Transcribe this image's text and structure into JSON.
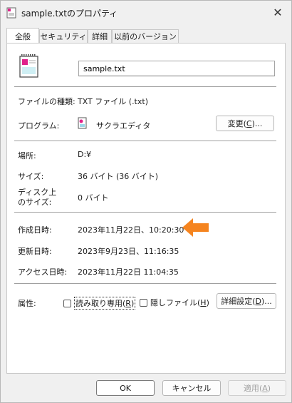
{
  "window": {
    "title": "sample.txtのプロパティ",
    "close_glyph": "✕"
  },
  "tabs": [
    {
      "label": "全般",
      "active": true
    },
    {
      "label": "セキュリティ"
    },
    {
      "label": "詳細"
    },
    {
      "label": "以前のバージョン"
    }
  ],
  "general": {
    "filename_value": "sample.txt",
    "file_type_label": "ファイルの種類:",
    "file_type_value": "TXT ファイル (.txt)",
    "program_label": "プログラム:",
    "program_value": "サクラエディタ",
    "change_button_label": "変更",
    "change_button_key": "C",
    "location_label": "場所:",
    "location_value": "D:¥",
    "size_label": "サイズ:",
    "size_value": "36 バイト (36 バイト)",
    "disk_size_label_line1": "ディスク上",
    "disk_size_label_line2": "のサイズ:",
    "disk_size_value": "0 バイト",
    "created_label": "作成日時:",
    "created_value": "2023年11月22日、10:20:30",
    "modified_label": "更新日時:",
    "modified_value": "2023年9月23日、11:16:35",
    "accessed_label": "アクセス日時:",
    "accessed_value": "2023年11月22日 11:04:35",
    "attributes_label": "属性:",
    "readonly_label": "読み取り専用",
    "readonly_key": "R",
    "readonly_checked": false,
    "hidden_label": "隠しファイル",
    "hidden_key": "H",
    "hidden_checked": false,
    "advanced_button_label": "詳細設定",
    "advanced_button_key": "D"
  },
  "footer": {
    "ok_label": "OK",
    "cancel_label": "キャンセル",
    "apply_label": "適用",
    "apply_key": "A"
  },
  "colors": {
    "arrow": "#f5841f",
    "accent_pink": "#e0218a"
  }
}
